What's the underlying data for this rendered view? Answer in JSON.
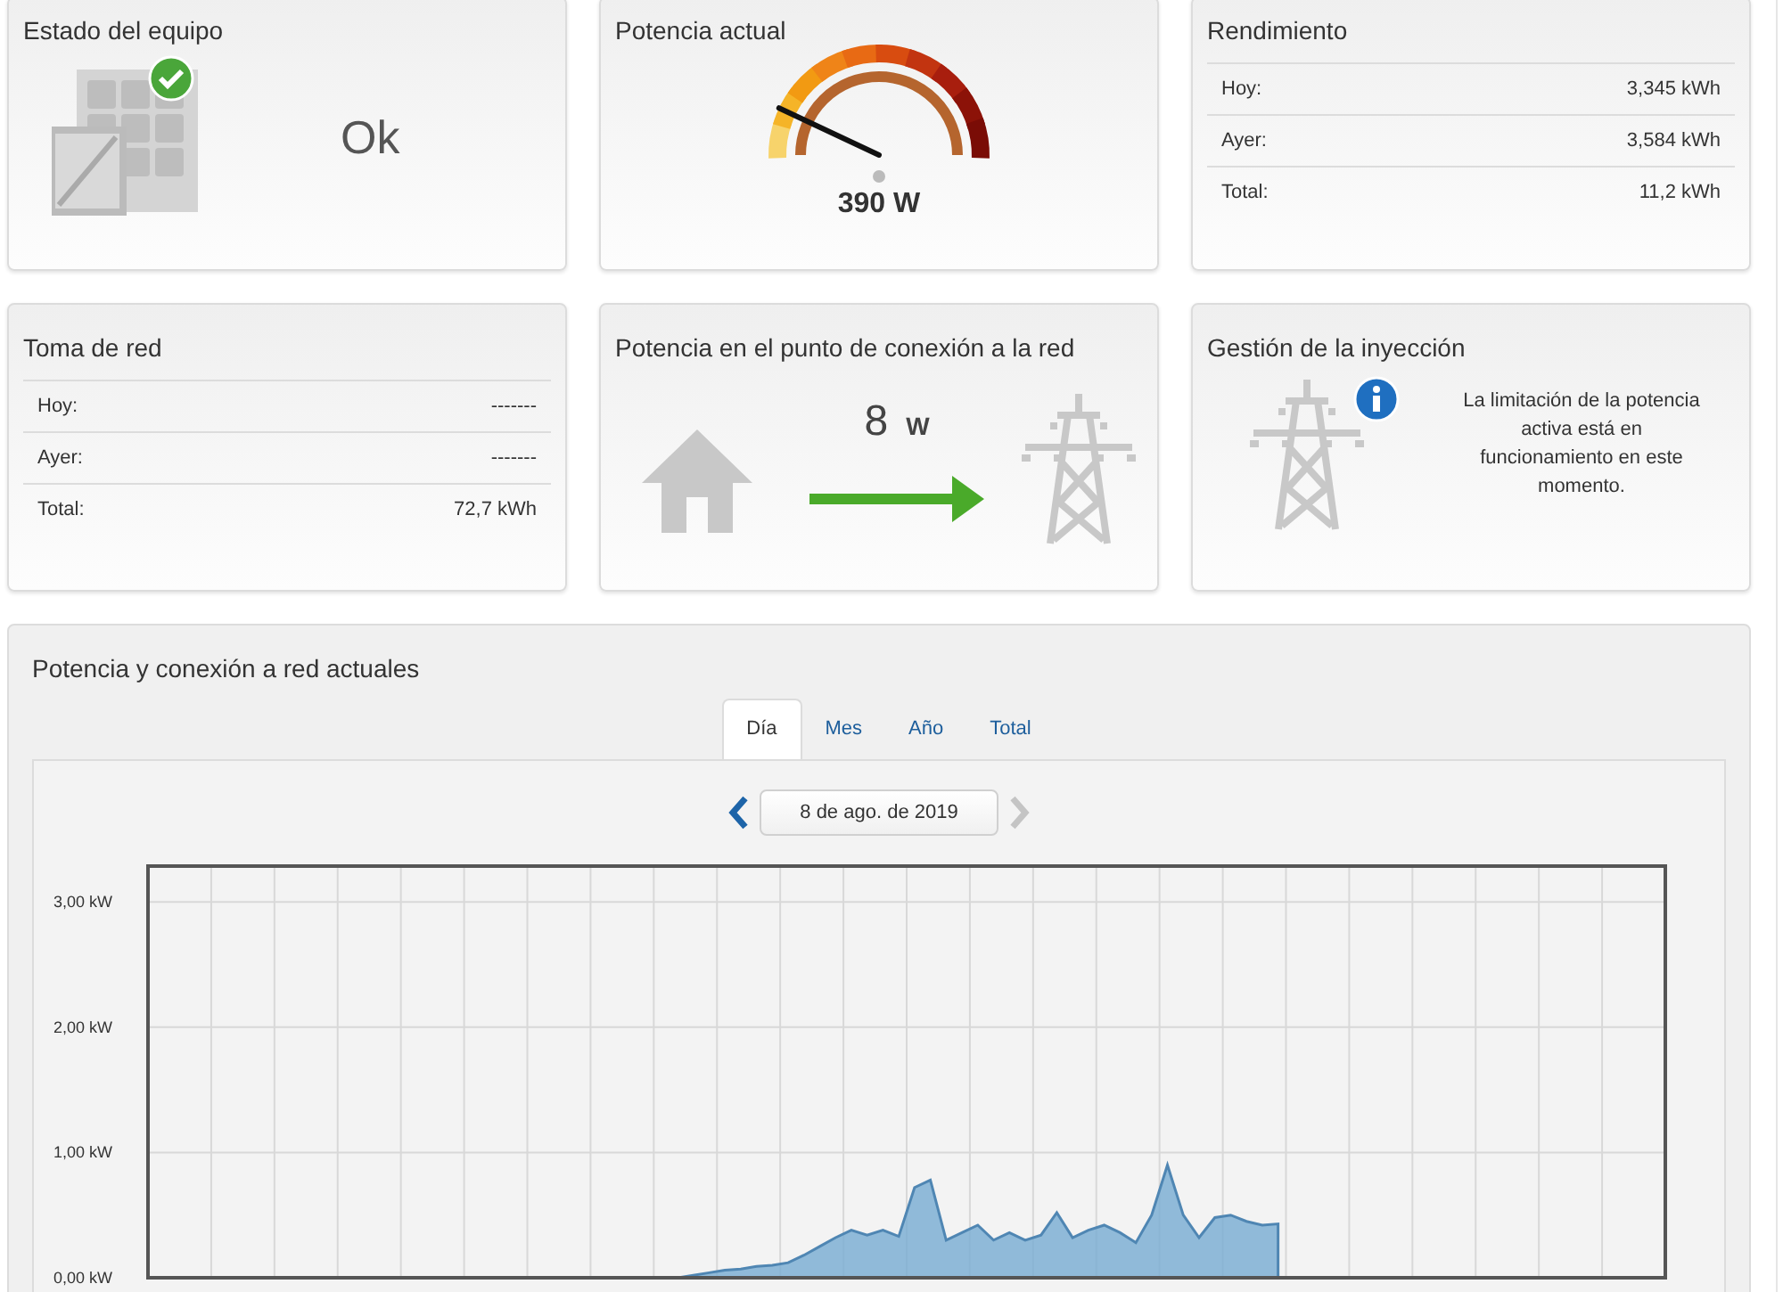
{
  "equipment_status": {
    "title": "Estado del equipo",
    "status": "Ok"
  },
  "current_power": {
    "title": "Potencia actual",
    "value": "390 W",
    "level": 0.14
  },
  "yield": {
    "title": "Rendimiento",
    "rows": [
      {
        "label": "Hoy:",
        "value": "3,345 kWh"
      },
      {
        "label": "Ayer:",
        "value": "3,584 kWh"
      },
      {
        "label": "Total:",
        "value": "11,2 kWh"
      }
    ]
  },
  "grid_consumption": {
    "title": "Toma de red",
    "rows": [
      {
        "label": "Hoy:",
        "value": "-------"
      },
      {
        "label": "Ayer:",
        "value": "-------"
      },
      {
        "label": "Total:",
        "value": "72,7 kWh"
      }
    ]
  },
  "grid_point_power": {
    "title": "Potencia en el punto de conexión a la red",
    "value": "8",
    "unit": "W"
  },
  "feed_in_management": {
    "title": "Gestión de la inyección",
    "message": "La limitación de la potencia activa está en funcionamiento en este momento."
  },
  "chart_panel": {
    "title": "Potencia y conexión a red actuales",
    "tabs": [
      {
        "label": "Día",
        "selected": true
      },
      {
        "label": "Mes",
        "selected": false
      },
      {
        "label": "Año",
        "selected": false
      },
      {
        "label": "Total",
        "selected": false
      }
    ],
    "date": "8 de ago. de 2019",
    "chart_data": {
      "type": "area",
      "ylim": [
        0,
        3.3
      ],
      "grid": true,
      "yticks": [
        {
          "value": 0,
          "label": "0,00 kW"
        },
        {
          "value": 1,
          "label": "1,00 kW"
        },
        {
          "value": 2,
          "label": "2,00 kW"
        },
        {
          "value": 3,
          "label": "3,00 kW"
        }
      ],
      "categories": [
        null,
        null,
        null,
        null,
        null,
        null,
        null,
        null,
        null,
        null,
        null,
        null,
        null,
        null,
        null,
        null,
        null,
        null,
        null,
        null,
        null,
        null,
        null,
        null,
        null,
        null,
        null,
        null,
        null,
        null,
        null,
        null,
        null,
        null,
        null,
        null,
        null,
        null,
        null,
        null,
        null,
        null,
        null,
        null,
        null,
        null,
        null,
        null,
        null,
        null,
        null,
        null,
        null,
        null,
        null,
        null,
        null,
        null,
        null,
        null,
        null,
        null,
        null,
        null,
        null,
        null,
        null,
        null,
        null,
        null,
        null,
        null,
        null,
        null,
        null,
        null,
        null,
        null,
        null,
        null,
        null,
        null,
        null,
        null,
        null,
        null,
        null,
        null,
        null,
        null,
        null,
        null,
        null,
        null,
        null,
        null
      ],
      "series": [
        {
          "color": "#7eafd4",
          "values": [
            null,
            null,
            null,
            null,
            null,
            null,
            null,
            null,
            null,
            null,
            null,
            null,
            null,
            null,
            null,
            null,
            null,
            null,
            null,
            null,
            null,
            null,
            null,
            null,
            null,
            null,
            null,
            null,
            null,
            null,
            null,
            0,
            0,
            0,
            0.02,
            0.04,
            0.06,
            0.07,
            0.09,
            0.1,
            0.12,
            0.18,
            0.25,
            0.32,
            0.38,
            0.34,
            0.38,
            0.33,
            0.72,
            0.78,
            0.3,
            0.36,
            0.42,
            0.3,
            0.36,
            0.3,
            0.34,
            0.52,
            0.32,
            0.38,
            0.42,
            0.36,
            0.28,
            0.5,
            0.9,
            0.5,
            0.32,
            0.48,
            0.5,
            0.45,
            0.42,
            0.43,
            null,
            null,
            null,
            null,
            null,
            null,
            null,
            null,
            null,
            null,
            null,
            null,
            null,
            null,
            null,
            null,
            null,
            null,
            null,
            null,
            null,
            null,
            null,
            null
          ]
        }
      ]
    }
  }
}
